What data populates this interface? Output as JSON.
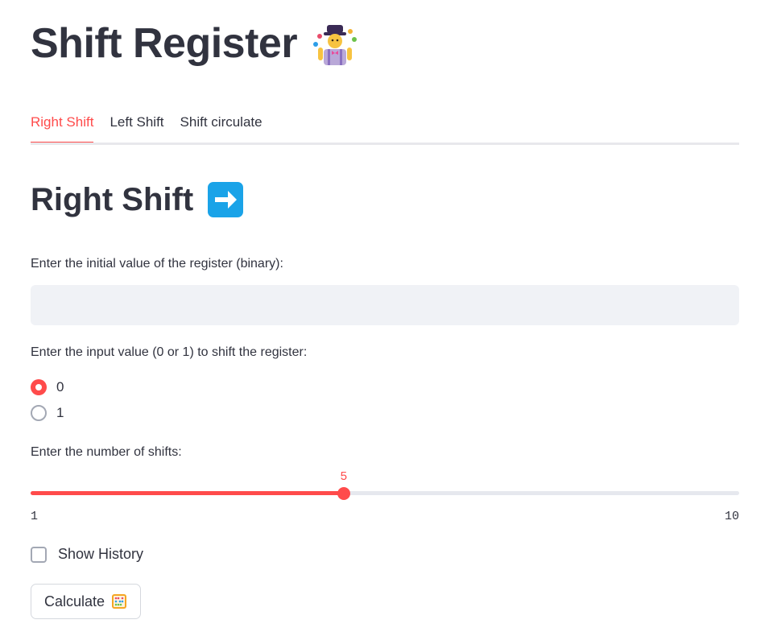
{
  "header": {
    "title": "Shift Register",
    "title_icon": "juggling-person-icon"
  },
  "tabs": [
    {
      "label": "Right Shift",
      "active": true
    },
    {
      "label": "Left Shift",
      "active": false
    },
    {
      "label": "Shift circulate",
      "active": false
    }
  ],
  "section": {
    "title": "Right Shift",
    "icon": "right-arrow-icon"
  },
  "register_input": {
    "label": "Enter the initial value of the register (binary):",
    "value": "",
    "placeholder": ""
  },
  "input_value": {
    "label": "Enter the input value (0 or 1) to shift the register:",
    "options": [
      "0",
      "1"
    ],
    "selected": "0"
  },
  "shifts_slider": {
    "label": "Enter the number of shifts:",
    "min": 1,
    "max": 10,
    "value": 5,
    "min_label": "1",
    "max_label": "10",
    "value_label": "5"
  },
  "history_checkbox": {
    "label": "Show History",
    "checked": false
  },
  "calculate_button": {
    "label": "Calculate",
    "icon": "abacus-icon"
  },
  "colors": {
    "accent": "#ff4b4b",
    "text": "#31333f",
    "input_bg": "#f0f2f6",
    "arrow_bg": "#1aa3e8"
  }
}
